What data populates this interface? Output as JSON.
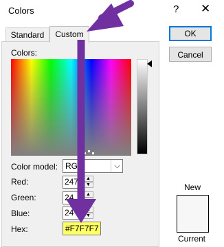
{
  "window": {
    "title": "Colors",
    "help_glyph": "?",
    "close_glyph": "✕"
  },
  "tabs": [
    {
      "label": "Standard",
      "active": false
    },
    {
      "label": "Custom",
      "active": true
    }
  ],
  "buttons": {
    "ok": "OK",
    "cancel": "Cancel"
  },
  "colors_label": "Colors:",
  "color_model": {
    "label": "Color model:",
    "value": "RG"
  },
  "fields": {
    "red": {
      "label": "Red:",
      "value": "247"
    },
    "green": {
      "label": "Green:",
      "value": "24"
    },
    "blue": {
      "label": "Blue:",
      "value": "24"
    },
    "hex": {
      "label": "Hex:",
      "value": "#F7F7F7"
    }
  },
  "preview": {
    "new_label": "New",
    "current_label": "Current",
    "color": "#F7F7F7"
  },
  "annotation": {
    "color": "#7030a0"
  }
}
